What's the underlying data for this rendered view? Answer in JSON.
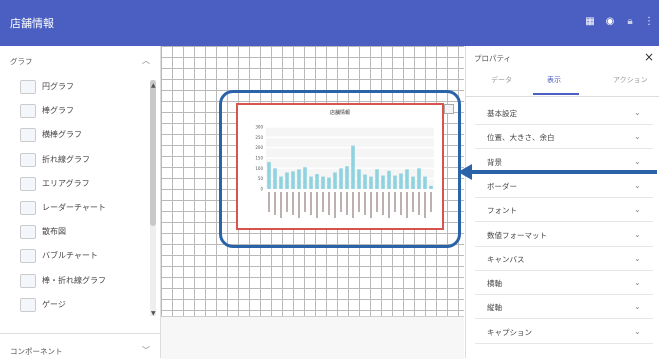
{
  "header": {
    "title": "店舗情報",
    "icons": [
      "grid-icon",
      "eye-icon",
      "lock-icon",
      "more-vert-icon"
    ]
  },
  "left_panel": {
    "section1": "グラフ",
    "section2": "コンポーネント",
    "items": [
      {
        "label": "円グラフ",
        "icon": "pie-chart-icon"
      },
      {
        "label": "棒グラフ",
        "icon": "bar-chart-icon"
      },
      {
        "label": "横棒グラフ",
        "icon": "hbar-chart-icon"
      },
      {
        "label": "折れ線グラフ",
        "icon": "line-chart-icon"
      },
      {
        "label": "エリアグラフ",
        "icon": "area-chart-icon"
      },
      {
        "label": "レーダーチャート",
        "icon": "radar-chart-icon"
      },
      {
        "label": "散布図",
        "icon": "scatter-chart-icon"
      },
      {
        "label": "バブルチャート",
        "icon": "bubble-chart-icon"
      },
      {
        "label": "棒・折れ線グラフ",
        "icon": "combo-chart-icon"
      },
      {
        "label": "ゲージ",
        "icon": "gauge-icon"
      }
    ]
  },
  "chart": {
    "title": "店舗情報",
    "y_ticks": [
      "300",
      "250",
      "200",
      "150",
      "100",
      "50",
      "0"
    ],
    "bars": [
      130,
      100,
      60,
      80,
      85,
      95,
      105,
      60,
      72,
      60,
      55,
      80,
      100,
      110,
      210,
      95,
      70,
      60,
      95,
      65,
      88,
      65,
      75,
      95,
      60,
      100,
      60,
      15
    ]
  },
  "right_panel": {
    "title": "プロパティ",
    "tabs": [
      "データ",
      "表示",
      "アクション"
    ],
    "active_tab": "表示",
    "props": [
      "基本設定",
      "位置、大きさ、余白",
      "背景",
      "ボーダー",
      "フォント",
      "数値フォーマット",
      "キャンバス",
      "横軸",
      "縦軸",
      "キャプション"
    ]
  }
}
